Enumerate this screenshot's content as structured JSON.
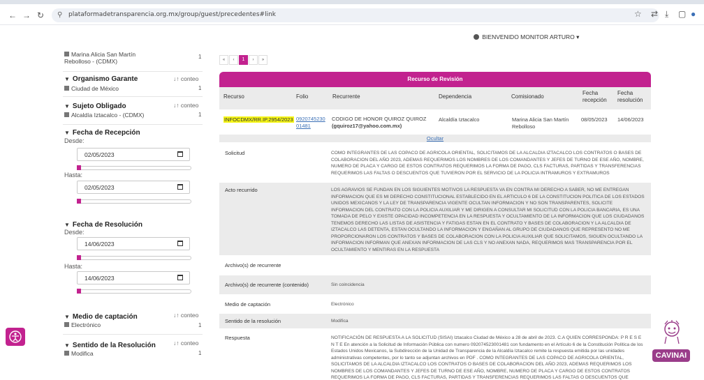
{
  "browser": {
    "url": "plataformadetransparencia.org.mx/group/guest/precedentes#link",
    "back_icon": "arrow-left-icon",
    "forward_icon": "arrow-right-icon",
    "reload_icon": "reload-icon"
  },
  "header": {
    "user_label": "BIENVENIDO MONITOR ARTURO",
    "caret": "▾"
  },
  "sidebar": {
    "top_item": {
      "label_line1": "Marina Alicia San Martín",
      "label_line2": "Rebolloso - (CDMX)",
      "count": "1"
    },
    "organismo": {
      "title": "Organismo Garante",
      "sort": "↓↑ conteo",
      "item": "Ciudad de México",
      "count": "1"
    },
    "sujeto": {
      "title": "Sujeto Obligado",
      "sort": "↓↑ conteo",
      "item": "Alcaldía Iztacalco - (CDMX)",
      "count": "1"
    },
    "fecha_recepcion": {
      "title": "Fecha de Recepción",
      "desde_label": "Desde:",
      "desde_value": "02/05/2023",
      "hasta_label": "Hasta:",
      "hasta_value": "02/05/2023",
      "desde_level": 0.0,
      "hasta_level": 0.0
    },
    "fecha_resolucion": {
      "title": "Fecha de Resolución",
      "desde_label": "Desde:",
      "desde_value": "14/06/2023",
      "hasta_label": "Hasta:",
      "hasta_value": "14/06/2023",
      "desde_level": 0.0,
      "hasta_level": 0.0
    },
    "medio": {
      "title": "Medio de captación",
      "sort": "↓↑ conteo",
      "item": "Electrónico",
      "count": "1"
    },
    "sentido": {
      "title": "Sentido de la Resolución",
      "sort": "↓↑ conteo",
      "item": "Modifica",
      "count": "1"
    }
  },
  "pager": {
    "first": "«",
    "prev": "‹",
    "current": "1",
    "next": "›",
    "last": "»"
  },
  "panel": {
    "title": "Recurso de Revisión",
    "columns": [
      "Recurso",
      "Folio",
      "Recurrente",
      "Dependencia",
      "Comisionado",
      "Fecha recepción",
      "Fecha resolución"
    ],
    "record": {
      "recurso": "INFOCDMX/RR.IP.2954/2023",
      "folio_line1": "0920745230",
      "folio_line2": "01481",
      "recurrente_line1": "CODIGO DE HONOR QUIROZ QUIROZ",
      "recurrente_line2": "(gquiroz17@yahoo.com.mx)",
      "dependencia": "Alcaldía Iztacalco",
      "comisionado_line1": "Marina Alicia San Martín",
      "comisionado_line2": "Rebolloso",
      "fecha_recepcion": "08/05/2023",
      "fecha_resolucion": "14/06/2023"
    },
    "ocultar": "Ocultar",
    "details": [
      {
        "label": "Solicitud",
        "value": "COMO INTEGRANTES DE LAS COPACO DE AGRICOLA ORIENTAL, SOLICITAMOS DE LA ALCALDIA IZTACALCO LOS CONTRATOS O BASES DE COLABORACION DEL AÑO 2023, ADEMAS REQUERIMOS LOS NOMBRES DE LOS COMANDANTES Y JEFES DE TURNO DE ESE AÑO, NOMBRE, NUMERO DE PLACA Y CARGO DE ESTOS CONTRATOS REQUERIMOS LA FORMA DE PAGO, CLS FACTURAS, PARTIDAS Y TRANSFERENCIAS REQUERIMOS LAS FALTAS O DESCUENTOS QUE TUVIERON POR EL SERVICIO DE LA POLICIA INTRAMUROS Y EXTRAMUROS"
      },
      {
        "label": "Acto recurrido",
        "value": "LOS AGRAVIOS SE FUNDAN EN LOS SIGUIENTES MOTIVOS LA RESPUESTA VA EN CONTRA MI DERECHO A SABER, NO ME ENTREGAN INFORMACION QUE ES MI DERECHO CONSTITUCIONAL ESTABLECIDO EN EL ARTICULO 6 DE LA CONSTITUCION POLITICA DE LOS ESTADOS UNIDOS MEXICANOS Y LA LEY DE TRANSPARENCIA VIGENTE OCULTAN INFORMACION Y NO SON TRANSPARENTES, SOLICITE INFORMACION DEL CONTRATO CON LA POLICIA AUXILIAR Y ME DIRIGEN A CONSULTAR MI SOLICITUD CON LA POLICIA BANCARIA, ES UNA TOMADA DE PELO Y EXISTE OPACIDAD INCOMPETENCIA EN LA RESPUESTA Y OCULTAMIENTO DE LA INFORMACION QUE LOS CIUDADANOS TENEMOS DERECHO LAS LISTAS DE ASISTENCIA Y FATIGAS ESTAN EN EL CONTRATO Y BASES DE COLABORACION Y LA ALCALDIA DE IZTACALCO LAS DETENTA, ESTAN OCULTANDO LA INFORMACION Y ENGAÑAN AL GRUPO DE CIUDADANOS QUE REPRESENTO NO ME PROPORCIONARON LOS CONTRATOS Y BASES DE COLABORACION CON LA POLICIA AUXILIAR QUE SOLICITAMOS, SIGUEN OCULTANDO LA INFORMACION INFORMAN QUE ANEXAN INFORMACION DE LAS CLS Y NO ANEXAN NADA, REQUERIMOS MAS TRANSPARENCIA POR EL OCULTAMIENTO Y MENTIRAS EN LA RESPUESTA"
      },
      {
        "label": "Archivo(s) de recurrente",
        "value": ""
      },
      {
        "label": "Archivo(s) de recurrente (contenido)",
        "value": "Sin coincidencia"
      },
      {
        "label": "Medio de captación",
        "value": "Electrónico"
      },
      {
        "label": "Sentido de la resolución",
        "value": "Modifica"
      },
      {
        "label": "Respuesta",
        "value": "NOTIFICACIÓN DE RESPUESTA A LA SOLICITUD (SISAI) Iztacalco Ciudad de México a 28 de abril de 2023. C.A QUIEN CORRESPONDA: P R E S E N T E En atención a la Solicitud de Información Pública con numero 092074523001481 con fundamento en el Artículo 6 de la Constitución Política de los Estados Unidos Mexicanos, la Subdirección de la Unidad de Transparencia de la Alcaldía Iztacalco remite la respuesta emitida por las unidades administrativas competentes, por lo tanto se adjuntan archivos en PDF . COMO INTEGRANTES DE LAS COPACO DE AGRICOLA ORIENTAL, SOLICITAMOS DE LA ALCALDIA IZTACALCO LOS CONTRATOS O BASES DE COLABORACION DEL AÑO 2023, ADEMAS REQUERIMOS LOS NOMBRES DE LOS COMANDANTES Y JEFES DE TURNO DE ESE AÑO, NOMBRE, NUMERO DE PLACA Y CARGO DE ESTOS CONTRATOS REQUERIMOS LA FORMA DE PAGO, CLS FACTURAS, PARTIDAS Y TRANSFERENCIAS REQUERIMOS LAS FALTAS O DESCUENTOS QUE TUVIERON POR EL SERVICIO DE LA POLICIA"
      }
    ]
  },
  "badge": {
    "label": "CAVINAI"
  },
  "colors": {
    "accent": "#c2228f",
    "highlight": "#f5f516",
    "link": "#3a6fb6",
    "badge": "#9a3d8a"
  }
}
